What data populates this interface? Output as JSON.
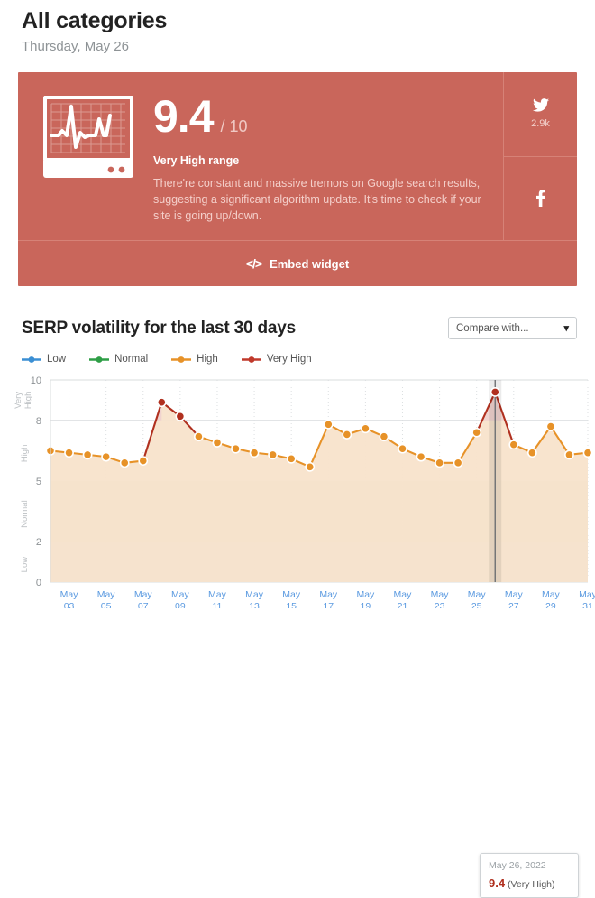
{
  "header": {
    "title": "All categories",
    "date": "Thursday, May 26"
  },
  "card": {
    "bg_color": "#c9665b",
    "icon": "monitor-pulse-icon",
    "score": "9.4",
    "score_max": "/ 10",
    "range_label": "Very High range",
    "description": "There're constant and massive tremors on Google search results, suggesting a significant algorithm update. It's time to check if your site is going up/down.",
    "social": [
      {
        "icon": "twitter-icon",
        "count": "2.9k"
      },
      {
        "icon": "facebook-icon",
        "count": ""
      }
    ],
    "embed": {
      "icon": "code-brackets-icon",
      "label": "Embed widget"
    }
  },
  "chart_section": {
    "title": "SERP volatility for the last 30 days",
    "compare": {
      "value": "Compare with...",
      "placeholder": "Compare with...",
      "chevron": "chevron-down-icon"
    }
  },
  "tooltip": {
    "date": "May 26, 2022",
    "value": "9.4",
    "range": "(Very High)"
  },
  "chart_data": {
    "type": "line",
    "title": "SERP volatility for the last 30 days",
    "xlabel": "",
    "ylabel": "",
    "ylim": [
      0,
      10
    ],
    "yticks": [
      0,
      2,
      5,
      8,
      10
    ],
    "grid": true,
    "legend_position": "top-left",
    "legend": [
      {
        "name": "Low",
        "color": "#3b8fd4"
      },
      {
        "name": "Normal",
        "color": "#2e9e46"
      },
      {
        "name": "High",
        "color": "#e79228"
      },
      {
        "name": "Very High",
        "color": "#c0392b"
      }
    ],
    "bands": [
      {
        "name": "Low",
        "from": 0,
        "to": 2,
        "color": "#cfe0ee"
      },
      {
        "name": "Normal",
        "from": 2,
        "to": 5,
        "color": "#d8e6d2"
      },
      {
        "name": "High",
        "from": 5,
        "to": 8,
        "color": "#ffffff"
      },
      {
        "name": "Very High",
        "from": 8,
        "to": 10,
        "color": "#ffffff"
      }
    ],
    "band_axis_labels": [
      "Very High",
      "High",
      "Normal",
      "Low"
    ],
    "xticks": [
      "May 03",
      "May 05",
      "May 07",
      "May 09",
      "May 11",
      "May 13",
      "May 15",
      "May 17",
      "May 19",
      "May 21",
      "May 23",
      "May 25",
      "May 27",
      "May 29",
      "May 31"
    ],
    "x": [
      "May 02",
      "May 03",
      "May 04",
      "May 05",
      "May 06",
      "May 07",
      "May 08",
      "May 09",
      "May 10",
      "May 11",
      "May 12",
      "May 13",
      "May 14",
      "May 15",
      "May 16",
      "May 17",
      "May 18",
      "May 19",
      "May 20",
      "May 21",
      "May 22",
      "May 23",
      "May 24",
      "May 25",
      "May 26",
      "May 27",
      "May 28",
      "May 29",
      "May 30",
      "May 31"
    ],
    "values": [
      6.5,
      6.4,
      6.3,
      6.2,
      5.9,
      6.0,
      8.9,
      8.2,
      7.2,
      6.9,
      6.6,
      6.4,
      6.3,
      6.1,
      5.7,
      7.8,
      7.3,
      7.6,
      7.2,
      6.6,
      6.2,
      5.9,
      5.9,
      7.4,
      9.4,
      6.8,
      6.4,
      7.7,
      6.3,
      6.4
    ],
    "highlight_index": 24,
    "highlight_value": 9.4,
    "series_color_high": "#e79228",
    "series_color_very_high": "#b0301f",
    "area_fill_high": "#f8e3cb",
    "area_fill_very_high": "#f0d3cf"
  }
}
